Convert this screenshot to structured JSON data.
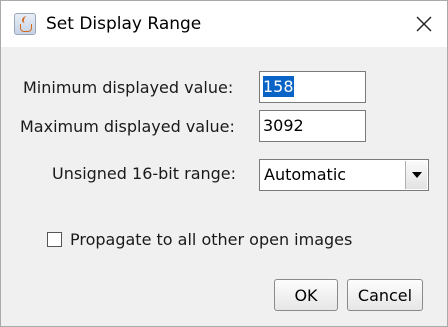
{
  "window": {
    "title": "Set Display Range",
    "icon": "java-icon",
    "close": "close-icon"
  },
  "fields": {
    "min_label": "Minimum displayed value:",
    "min_value": "158",
    "max_label": "Maximum displayed value:",
    "max_value": "3092",
    "range_label": "Unsigned 16-bit range:",
    "range_value": "Automatic"
  },
  "options": {
    "propagate_label": "Propagate to all other open images",
    "propagate_checked": false
  },
  "buttons": {
    "ok": "OK",
    "cancel": "Cancel"
  },
  "colors": {
    "selection": "#0a64c8",
    "dialog_bg": "#f0f0f0"
  }
}
